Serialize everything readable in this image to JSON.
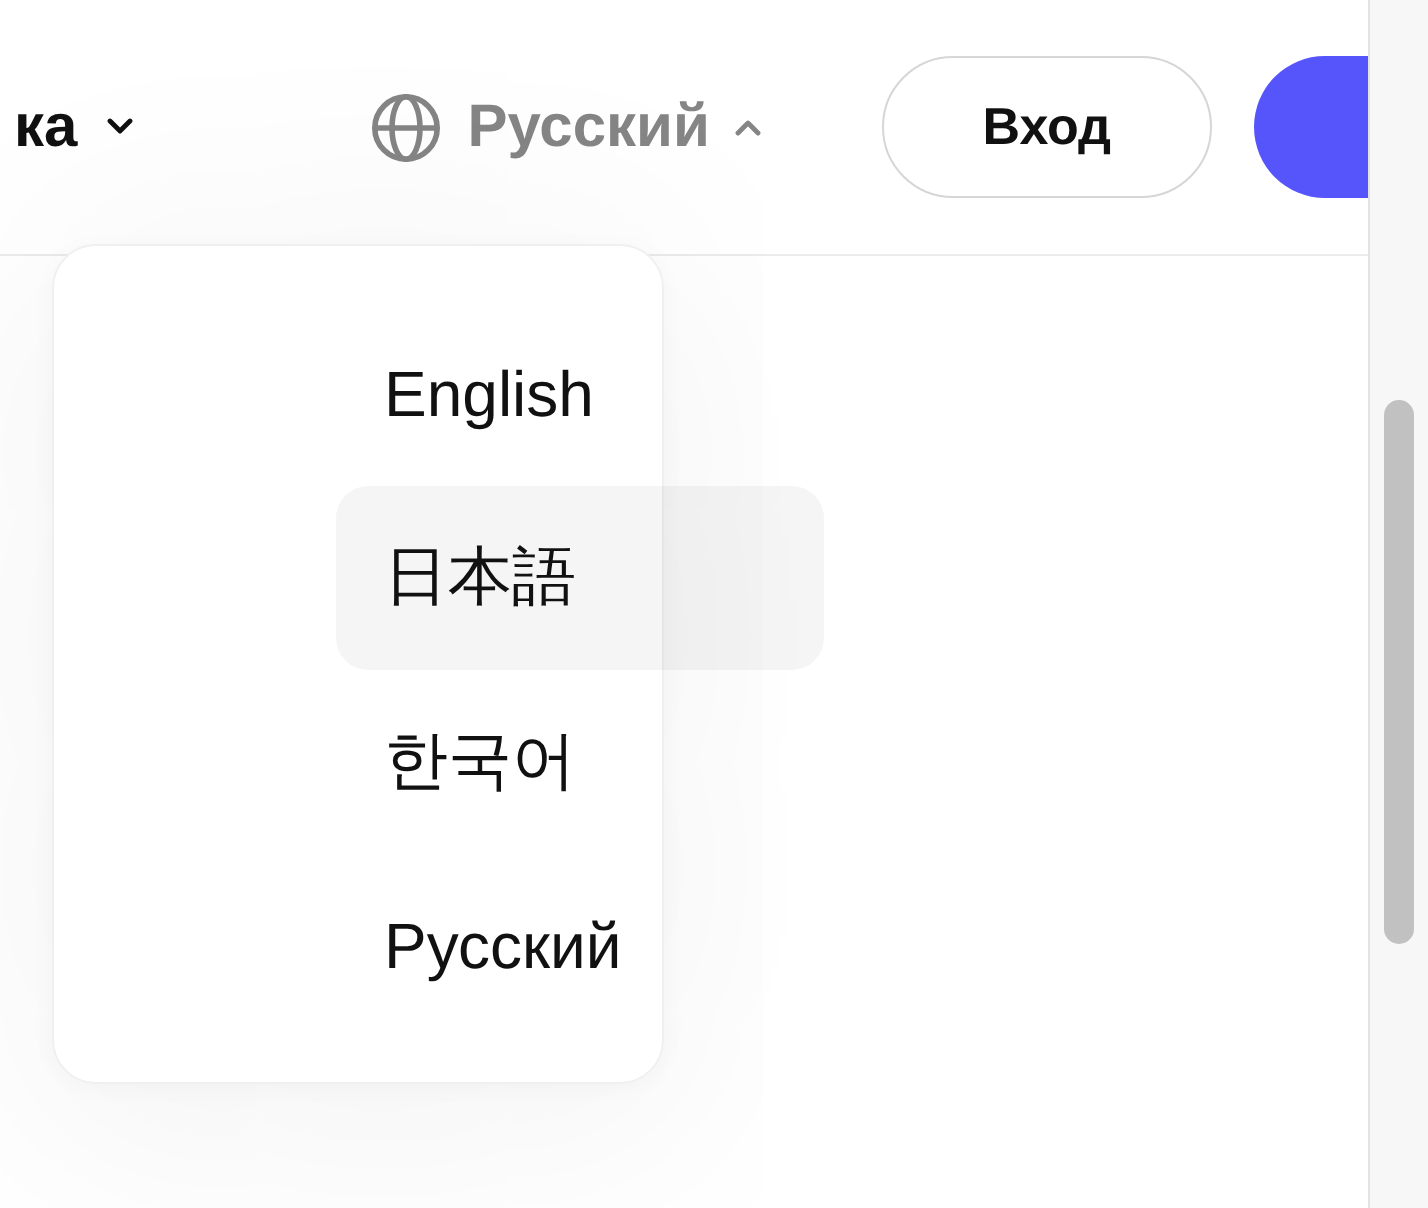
{
  "header": {
    "nav_link": {
      "label": "ка",
      "expanded": false
    },
    "language": {
      "label": "Русский",
      "expanded": true
    },
    "login_button": {
      "label": "Вход"
    }
  },
  "language_menu": {
    "items": [
      {
        "label": "English",
        "highlighted": false
      },
      {
        "label": "日本語",
        "highlighted": true
      },
      {
        "label": "한국어",
        "highlighted": false
      },
      {
        "label": "Русский",
        "highlighted": false
      }
    ]
  }
}
